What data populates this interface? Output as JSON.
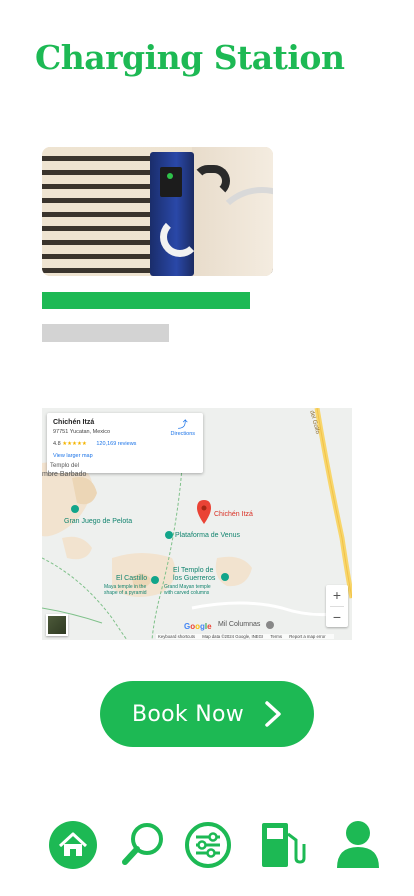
{
  "page": {
    "title": "Charging Station"
  },
  "station": {
    "photo_alt": "EV charging station photo"
  },
  "map": {
    "card": {
      "place_name": "Chichén Itzá",
      "address": "97751 Yucatan, Mexico",
      "rating": "4.8",
      "stars": "★★★★★",
      "reviews": "120,169 reviews",
      "larger_map": "View larger map",
      "directions": "Directions"
    },
    "labels": {
      "gran_juego": "Gran Juego de Pelota",
      "chichen": "Chichén Itzá",
      "plataforma": "Plataforma de Venus",
      "templo_1": "El Templo de",
      "templo_2": "los Guerreros",
      "templo_sub_1": "Grand Mayan temple",
      "templo_sub_2": "with carved columns",
      "castillo": "El Castillo",
      "castillo_sub_1": "Maya temple in the",
      "castillo_sub_2": "shape of a pyramid",
      "mil_columnas": "Mil Columnas",
      "barbado": "mbre Barbado",
      "templo_top": "Templo del",
      "road": "del Golfo"
    },
    "zoom_in": "+",
    "zoom_out": "−",
    "google": [
      "G",
      "o",
      "o",
      "g",
      "l",
      "e"
    ],
    "footer": {
      "shortcuts": "Keyboard shortcuts",
      "data": "Map data ©2024 Google, INEGI",
      "terms": "Terms",
      "report": "Report a map error"
    }
  },
  "actions": {
    "book_now": "Book Now"
  },
  "nav": {
    "home": "home-icon",
    "search": "search-icon",
    "filters": "sliders-icon",
    "stations": "fuel-pump-icon",
    "profile": "user-icon"
  },
  "colors": {
    "accent": "#1db954",
    "placeholder": "#d3d3d3"
  }
}
